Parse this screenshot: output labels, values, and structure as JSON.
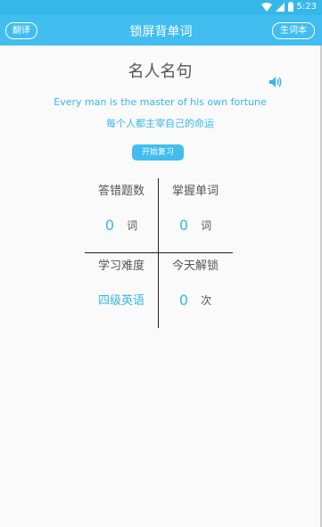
{
  "status_bar": {
    "time": "5:23"
  },
  "app_bar": {
    "title": "锁屏背单词",
    "left_button": "翻译",
    "right_button": "生词本"
  },
  "quote": {
    "heading": "名人名句",
    "english": "Every man is the master of his own  fortune",
    "chinese": "每个人都主宰自己的命运",
    "speaker_icon": "speaker-icon"
  },
  "review_button": "开始复习",
  "stats": {
    "wrong_answers": {
      "label": "答错题数",
      "value": "0",
      "unit": "词"
    },
    "mastered": {
      "label": "掌握单词",
      "value": "0",
      "unit": "词"
    },
    "difficulty": {
      "label": "学习难度",
      "value": "四级英语"
    },
    "unlocks_today": {
      "label": "今天解锁",
      "value": "0",
      "unit": "次"
    }
  },
  "colors": {
    "accent": "#41bdf0",
    "text": "#555555"
  }
}
